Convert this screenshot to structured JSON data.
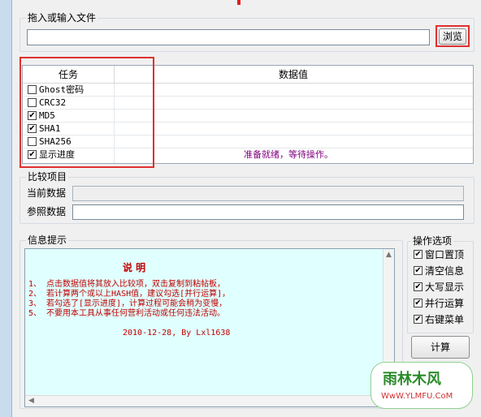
{
  "file_group": {
    "legend": "拖入或输入文件",
    "path_value": "",
    "browse_label": "浏览"
  },
  "task_grid": {
    "col_task": "任务",
    "col_value": "数据值",
    "rows": [
      {
        "label": "Ghost密码",
        "checked": false
      },
      {
        "label": "CRC32",
        "checked": false
      },
      {
        "label": "MD5",
        "checked": true
      },
      {
        "label": "SHA1",
        "checked": true
      },
      {
        "label": "SHA256",
        "checked": false
      },
      {
        "label": "显示进度",
        "checked": true
      }
    ],
    "status": "准备就绪，等待操作。",
    "status_color": "#800080"
  },
  "compare_group": {
    "legend": "比较项目",
    "current_label": "当前数据",
    "current_value": "",
    "reference_label": "参照数据",
    "reference_value": ""
  },
  "info_group": {
    "legend": "信息提示",
    "title": "说 明",
    "lines": [
      "1、 点击数据值将其放入比较项，双击复制到粘帖板，",
      "2、 若计算两个或以上HASH值，建议勾选[并行运算]，",
      "3、 若勾选了[显示进度]，计算过程可能会稍为变慢，",
      "5、 不要用本工具从事任何营利活动或任何违法活动。"
    ],
    "signature": "2010-12-28, By Lxl1638",
    "text_color": "#c00000",
    "background": "#e0ffff"
  },
  "options_group": {
    "legend": "操作选项",
    "items": [
      {
        "label": "窗口置顶",
        "checked": true
      },
      {
        "label": "清空信息",
        "checked": true
      },
      {
        "label": "大写显示",
        "checked": true
      },
      {
        "label": "并行运算",
        "checked": true
      },
      {
        "label": "右键菜单",
        "checked": true
      }
    ],
    "calc_label": "计算"
  },
  "watermark": {
    "text": "雨林木风",
    "url": "WwW.YLMFU.CoM"
  },
  "check_mark": "✔",
  "annotation_color": "#e03030"
}
